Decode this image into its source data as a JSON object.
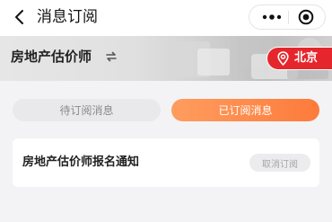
{
  "nav": {
    "title": "消息订阅",
    "icons": [
      "back-icon",
      "more-icon",
      "close-icon"
    ]
  },
  "banner": {
    "title": "房地产估价师",
    "switch_icon": "switch-icon",
    "city": "北京",
    "city_icon": "location-icon",
    "city_badge_color": "#e5262c"
  },
  "tabs": [
    {
      "label": "待订阅消息",
      "active": false
    },
    {
      "label": "已订阅消息",
      "active": true
    }
  ],
  "subscriptions": [
    {
      "title": "房地产估价师报名通知",
      "action_label": "取消订阅"
    }
  ],
  "colors": {
    "accent_start": "#fe9d5f",
    "accent_end": "#fd7b3b",
    "background": "#f3f3f5"
  }
}
